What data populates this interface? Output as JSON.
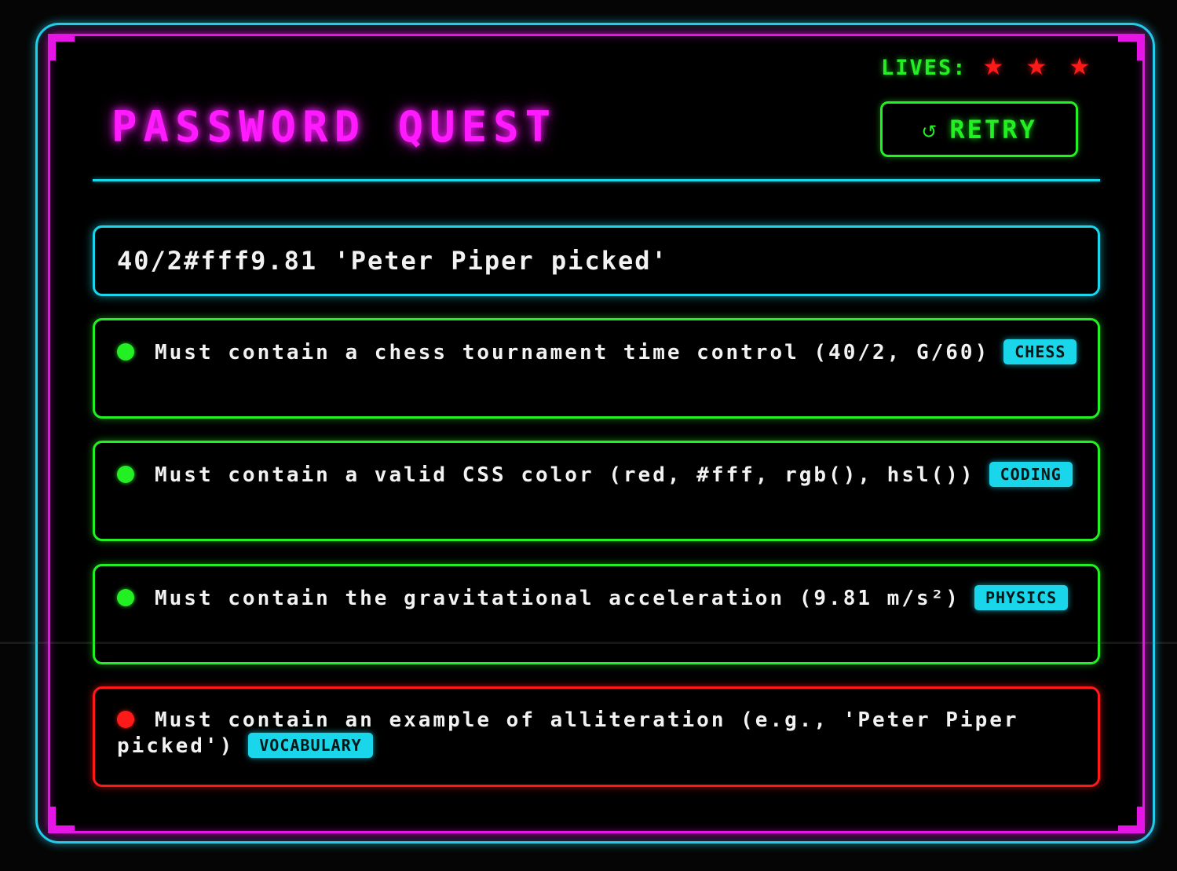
{
  "header": {
    "lives_label": "LIVES:",
    "lives": [
      "★",
      "★",
      "★"
    ],
    "title": "PASSWORD QUEST",
    "retry_icon": "↺",
    "retry_label": "RETRY"
  },
  "password": {
    "value": "40/2#fff9.81 'Peter Piper picked'"
  },
  "rules": [
    {
      "status": "passed",
      "text": "Must contain a chess tournament time control (40/2, G/60)",
      "tag": "CHESS"
    },
    {
      "status": "passed",
      "text": "Must contain a valid CSS color (red, #fff, rgb(), hsl())",
      "tag": "CODING"
    },
    {
      "status": "passed",
      "text": "Must contain the gravitational acceleration (9.81 m/s²)",
      "tag": "PHYSICS"
    },
    {
      "status": "failed",
      "text": "Must contain an example of alliteration (e.g., 'Peter Piper picked')",
      "tag": "VOCABULARY"
    }
  ],
  "colors": {
    "frame_cyan": "#19d6ea",
    "frame_magenta": "#e515e5",
    "pass_green": "#22f022",
    "fail_red": "#ff1a1a"
  }
}
